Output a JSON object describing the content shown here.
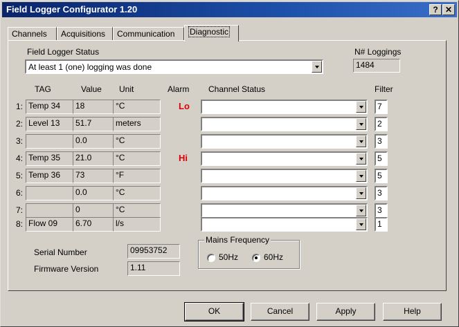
{
  "window": {
    "title": "Field Logger Configurator 1.20",
    "help_btn": "?",
    "close_btn": "✕"
  },
  "tabs": [
    "Channels",
    "Acquisitions",
    "Communication",
    "Diagnostic"
  ],
  "status": {
    "label": "Field Logger Status",
    "value": "At least 1 (one) logging was done",
    "loggings_label": "N# Loggings",
    "loggings_value": "1484"
  },
  "headers": {
    "tag": "TAG",
    "value": "Value",
    "unit": "Unit",
    "alarm": "Alarm",
    "channel_status": "Channel Status",
    "filter": "Filter"
  },
  "channels": [
    {
      "num": "1:",
      "tag": "Temp 34",
      "value": "18",
      "unit": "°C",
      "alarm": "Lo",
      "status": "",
      "filter": "7"
    },
    {
      "num": "2:",
      "tag": "Level 13",
      "value": "51.7",
      "unit": "meters",
      "alarm": "",
      "status": "",
      "filter": "2"
    },
    {
      "num": "3:",
      "tag": "",
      "value": "0.0",
      "unit": "°C",
      "alarm": "",
      "status": "",
      "filter": "3"
    },
    {
      "num": "4:",
      "tag": "Temp 35",
      "value": "21.0",
      "unit": "°C",
      "alarm": "Hi",
      "status": "",
      "filter": "5"
    },
    {
      "num": "5:",
      "tag": "Temp 36",
      "value": "73",
      "unit": "°F",
      "alarm": "",
      "status": "",
      "filter": "5"
    },
    {
      "num": "6:",
      "tag": "",
      "value": "0.0",
      "unit": "°C",
      "alarm": "",
      "status": "",
      "filter": "3"
    },
    {
      "num": "7:",
      "tag": "",
      "value": "0",
      "unit": "°C",
      "alarm": "",
      "status": "",
      "filter": "3"
    },
    {
      "num": "8:",
      "tag": "Flow 09",
      "value": "6.70",
      "unit": "l/s",
      "alarm": "",
      "status": "",
      "filter": "1"
    }
  ],
  "device": {
    "serial_label": "Serial Number",
    "serial_value": "09953752",
    "firmware_label": "Firmware Version",
    "firmware_value": "1.11"
  },
  "mains": {
    "title": "Mains Frequency",
    "option_50": "50Hz",
    "option_60": "60Hz",
    "selected": "60Hz"
  },
  "buttons": {
    "ok": "OK",
    "cancel": "Cancel",
    "apply": "Apply",
    "help": "Help"
  },
  "colors": {
    "title_bar": "#0a246a",
    "alarm_text": "#e00000",
    "face": "#d4d0c8"
  }
}
